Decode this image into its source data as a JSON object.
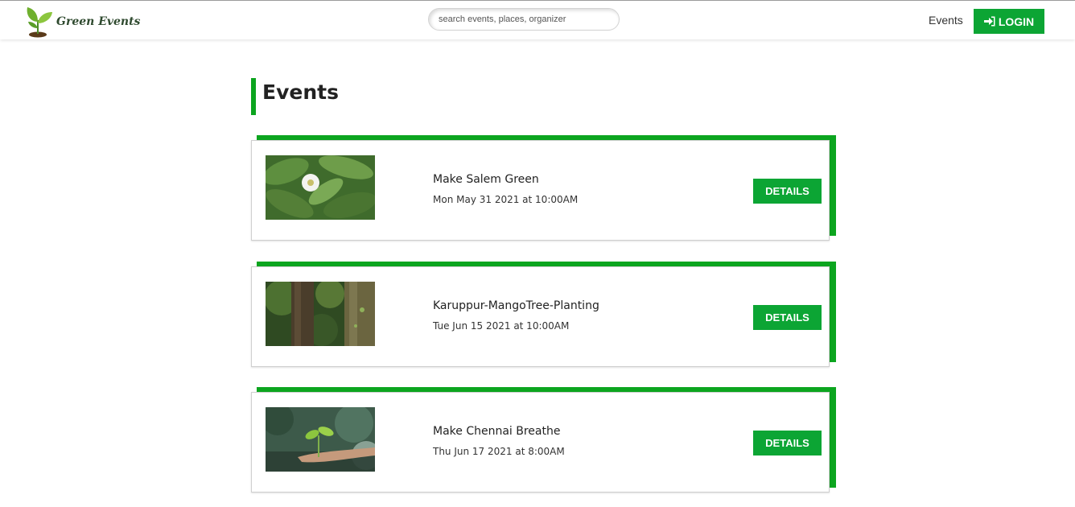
{
  "header": {
    "brand": "Green Events",
    "search_placeholder": "search events, places, organizer",
    "nav_events": "Events",
    "login_label": "LOGIN"
  },
  "main": {
    "title": "Events",
    "events": [
      {
        "name": "Make Salem Green",
        "date": "Mon May 31 2021 at 10:00AM",
        "details_label": "DETAILS",
        "image": "white-flower-leaves"
      },
      {
        "name": "Karuppur-MangoTree-Planting",
        "date": "Tue Jun 15 2021 at 10:00AM",
        "details_label": "DETAILS",
        "image": "tree-trunks-forest"
      },
      {
        "name": "Make Chennai Breathe",
        "date": "Thu Jun 17 2021 at 8:00AM",
        "details_label": "DETAILS",
        "image": "seedling-in-hand"
      }
    ]
  },
  "colors": {
    "accent": "#0ca51f",
    "button": "#0ca534"
  }
}
